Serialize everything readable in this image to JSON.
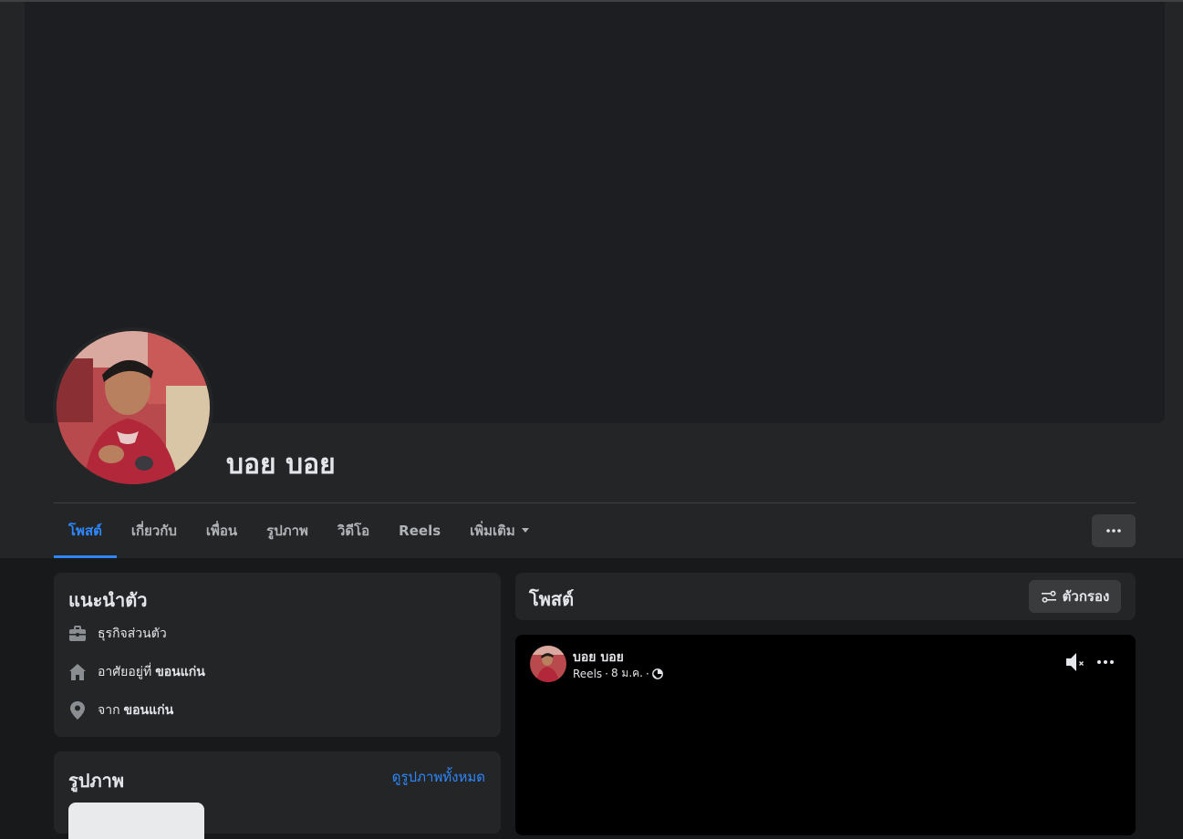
{
  "profile": {
    "name": "บอย บอย"
  },
  "tabs": [
    {
      "label": "โพสต์",
      "active": true
    },
    {
      "label": "เกี่ยวกับ",
      "active": false
    },
    {
      "label": "เพื่อน",
      "active": false
    },
    {
      "label": "รูปภาพ",
      "active": false
    },
    {
      "label": "วิดีโอ",
      "active": false
    },
    {
      "label": "Reels",
      "active": false
    },
    {
      "label": "เพิ่มเติม",
      "active": false
    }
  ],
  "intro": {
    "title": "แนะนำตัว",
    "work": "ธุรกิจส่วนตัว",
    "lives_prefix": "อาศัยอยู่ที่",
    "lives_place": "ขอนแก่น",
    "from_prefix": "จาก",
    "from_place": "ขอนแก่น"
  },
  "photos": {
    "title": "รูปภาพ",
    "see_all": "ดูรูปภาพทั้งหมด"
  },
  "posts": {
    "title": "โพสต์",
    "filter_label": "ตัวกรอง"
  },
  "post": {
    "author": "บอย บอย",
    "source": "Reels",
    "date": "8 ม.ค.",
    "separator": "·"
  },
  "icons": [
    "more-horizontal-icon",
    "briefcase-icon",
    "home-icon",
    "location-pin-icon",
    "filter-sliders-icon",
    "globe-icon",
    "muted-speaker-icon",
    "dropdown-caret-icon"
  ],
  "colors": {
    "accent": "#2d88ff",
    "background": "#18191a",
    "card": "#242526",
    "button": "#3a3b3c",
    "text": "#e4e6eb",
    "secondary_text": "#b0b3b8"
  }
}
